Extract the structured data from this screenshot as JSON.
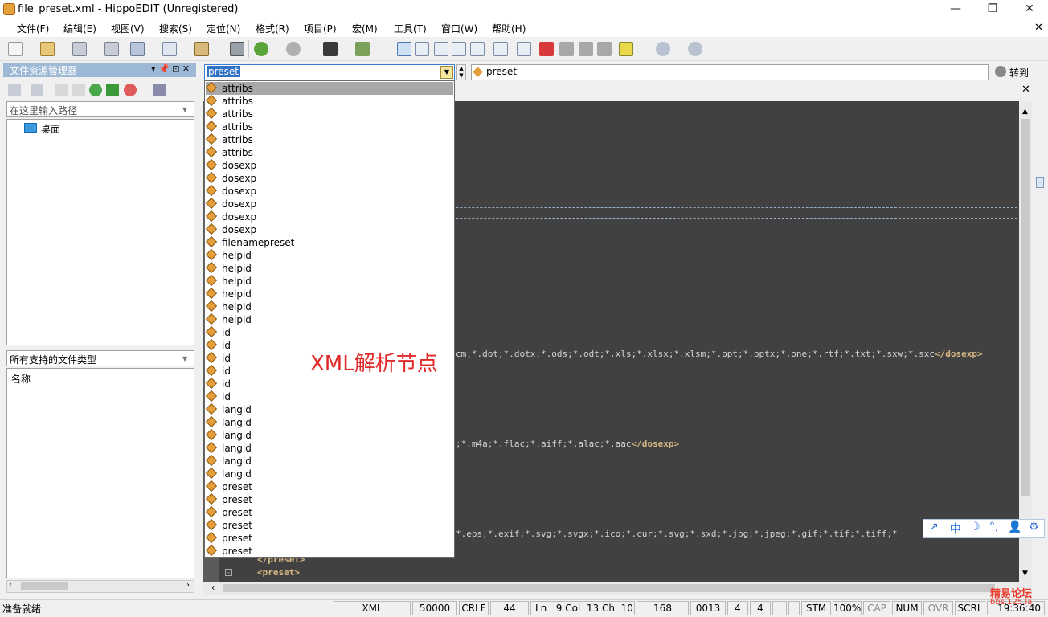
{
  "window": {
    "title": "file_preset.xml - HippoEDIT (Unregistered)",
    "min_glyph": "—",
    "max_glyph": "❐",
    "close_glyph": "✕",
    "doc_close_glyph": "✕"
  },
  "menu": [
    "文件(F)",
    "编辑(E)",
    "视图(V)",
    "搜索(S)",
    "定位(N)",
    "格式(R)",
    "项目(P)",
    "宏(M)",
    "工具(T)",
    "窗口(W)",
    "帮助(H)"
  ],
  "left_panel": {
    "title": "文件资源管理器",
    "pin_glyph": "▾ 📌 ⊡ ✕",
    "path_placeholder": "在这里输入路径",
    "tree_item": "桌面",
    "filter_label": "所有支持的文件类型",
    "column_name": "名称"
  },
  "nav": {
    "search_value": "preset",
    "location_value": "preset",
    "goto_label": "转到"
  },
  "dropdown_items": [
    "attribs",
    "attribs",
    "attribs",
    "attribs",
    "attribs",
    "attribs",
    "dosexp",
    "dosexp",
    "dosexp",
    "dosexp",
    "dosexp",
    "dosexp",
    "filenamepreset",
    "helpid",
    "helpid",
    "helpid",
    "helpid",
    "helpid",
    "helpid",
    "id",
    "id",
    "id",
    "id",
    "id",
    "id",
    "langid",
    "langid",
    "langid",
    "langid",
    "langid",
    "langid",
    "preset",
    "preset",
    "preset",
    "preset",
    "preset",
    "preset"
  ],
  "annotation": "XML解析节点",
  "code": {
    "line1_text": "cm;*.dot;*.dotx;*.ods;*.odt;*.xls;*.xlsx;*.xlsm;*.ppt;*.pptx;*.one;*.rtf;*.txt;*.sxw;*.sxc",
    "line1_close": "</dosexp>",
    "line2_text": ";*.m4a;*.flac;*.aiff;*.alac;*.aac",
    "line2_close": "</dosexp>",
    "line3_text": "*.eps;*.exif;*.svg;*.svgx;*.ico;*.cur;*.svg;*.sxd;*.jpg;*.jpeg;*.gif;*.tif;*.tiff;*",
    "line4_tag": "</preset>",
    "line5_tag": "<preset>"
  },
  "status": {
    "ready": "准备就绪",
    "lang": "XML",
    "size": "50000",
    "eol": "CRLF",
    "num44": "44",
    "pos": "Ln   9 Col  13 Ch  10",
    "n168": "168",
    "code": "0013",
    "n4a": "4",
    "n4b": "4",
    "stm": "STM",
    "zoom": "100%",
    "cap": "CAP",
    "num": "NUM",
    "ovr": "OVR",
    "scrl": "SCRL",
    "time": "19:36:40"
  },
  "watermark": {
    "line1": "精易论坛",
    "line2": "bbs.125.la"
  },
  "ime": [
    "↗",
    "中",
    "☽",
    "°,",
    "👤",
    "⚙"
  ]
}
